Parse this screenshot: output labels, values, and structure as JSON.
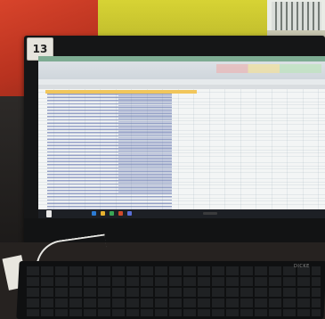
{
  "monitor": {
    "tag_number": "13"
  },
  "screen": {
    "app": "spreadsheet",
    "ribbon_colors": {
      "strip": "#2f7f4f",
      "highlight_row": "#f1c65b"
    },
    "taskbar_icon_colors": [
      "#2c7bd3",
      "#e6b12f",
      "#3aa655",
      "#d04a2b",
      "#5a6fd8"
    ]
  },
  "keyboard": {
    "brand": "DICKE"
  }
}
